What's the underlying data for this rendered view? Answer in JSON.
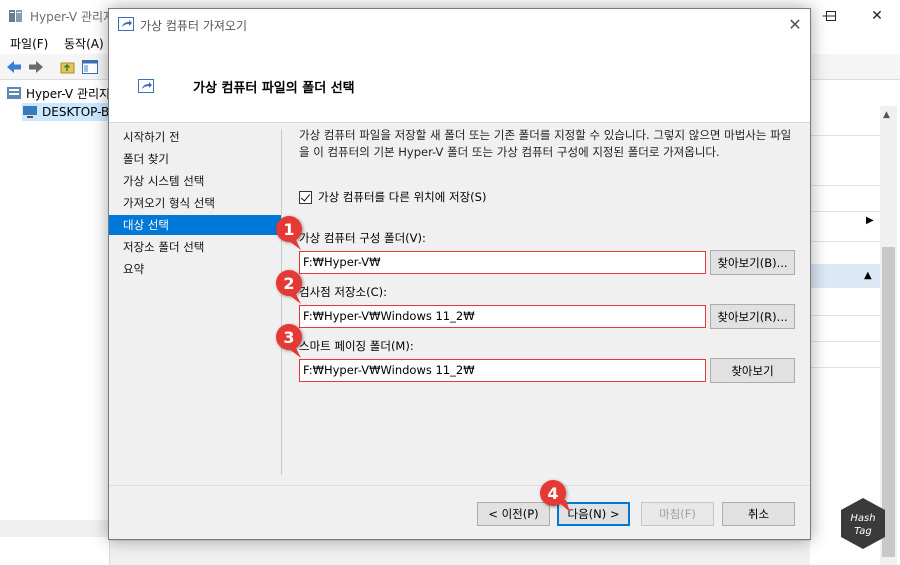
{
  "background_window": {
    "title": "Hyper-V 관리지",
    "menu": [
      "파일(F)",
      "동작(A)"
    ],
    "tree": [
      "Hyper-V 관리지",
      "DESKTOP-B"
    ]
  },
  "dialog": {
    "title": "가상 컴퓨터 가져오기",
    "header_title": "가상 컴퓨터 파일의 폴더 선택",
    "steps": [
      "시작하기 전",
      "폴더 찾기",
      "가상 시스템 선택",
      "가져오기 형식 선택",
      "대상 선택",
      "저장소 폴더 선택",
      "요약"
    ],
    "active_step": 4,
    "description": "가상 컴퓨터 파일을 저장할 새 폴더 또는 기존 폴더를 지정할 수 있습니다. 그렇지 않으면 마법사는 파일을 이 컴퓨터의 기본 Hyper-V 폴더 또는 가상 컴퓨터 구성에 지정된 폴더로 가져옵니다.",
    "save_elsewhere": {
      "label": "가상 컴퓨터를 다른 위치에 저장(S)",
      "checked": true
    },
    "fields": [
      {
        "label": "가상 컴퓨터 구성 폴더(V):",
        "value": "F:₩Hyper-V₩",
        "browse": "찾아보기(B)..."
      },
      {
        "label": "검사점 저장소(C):",
        "value": "F:₩Hyper-V₩Windows 11_2₩",
        "browse": "찾아보기(R)..."
      },
      {
        "label": "스마트 페이징 폴더(M):",
        "value": "F:₩Hyper-V₩Windows 11_2₩",
        "browse": "찾아보기"
      }
    ],
    "buttons": {
      "previous": "< 이전(P)",
      "next": "다음(N) >",
      "finish": "마침(F)",
      "cancel": "취소"
    }
  },
  "markers": [
    "1",
    "2",
    "3",
    "4"
  ],
  "watermark": [
    "Hash",
    "Tag"
  ],
  "colors": {
    "accent": "#0078d7",
    "marker": "#e53935",
    "highlight_border": "#e53935"
  }
}
